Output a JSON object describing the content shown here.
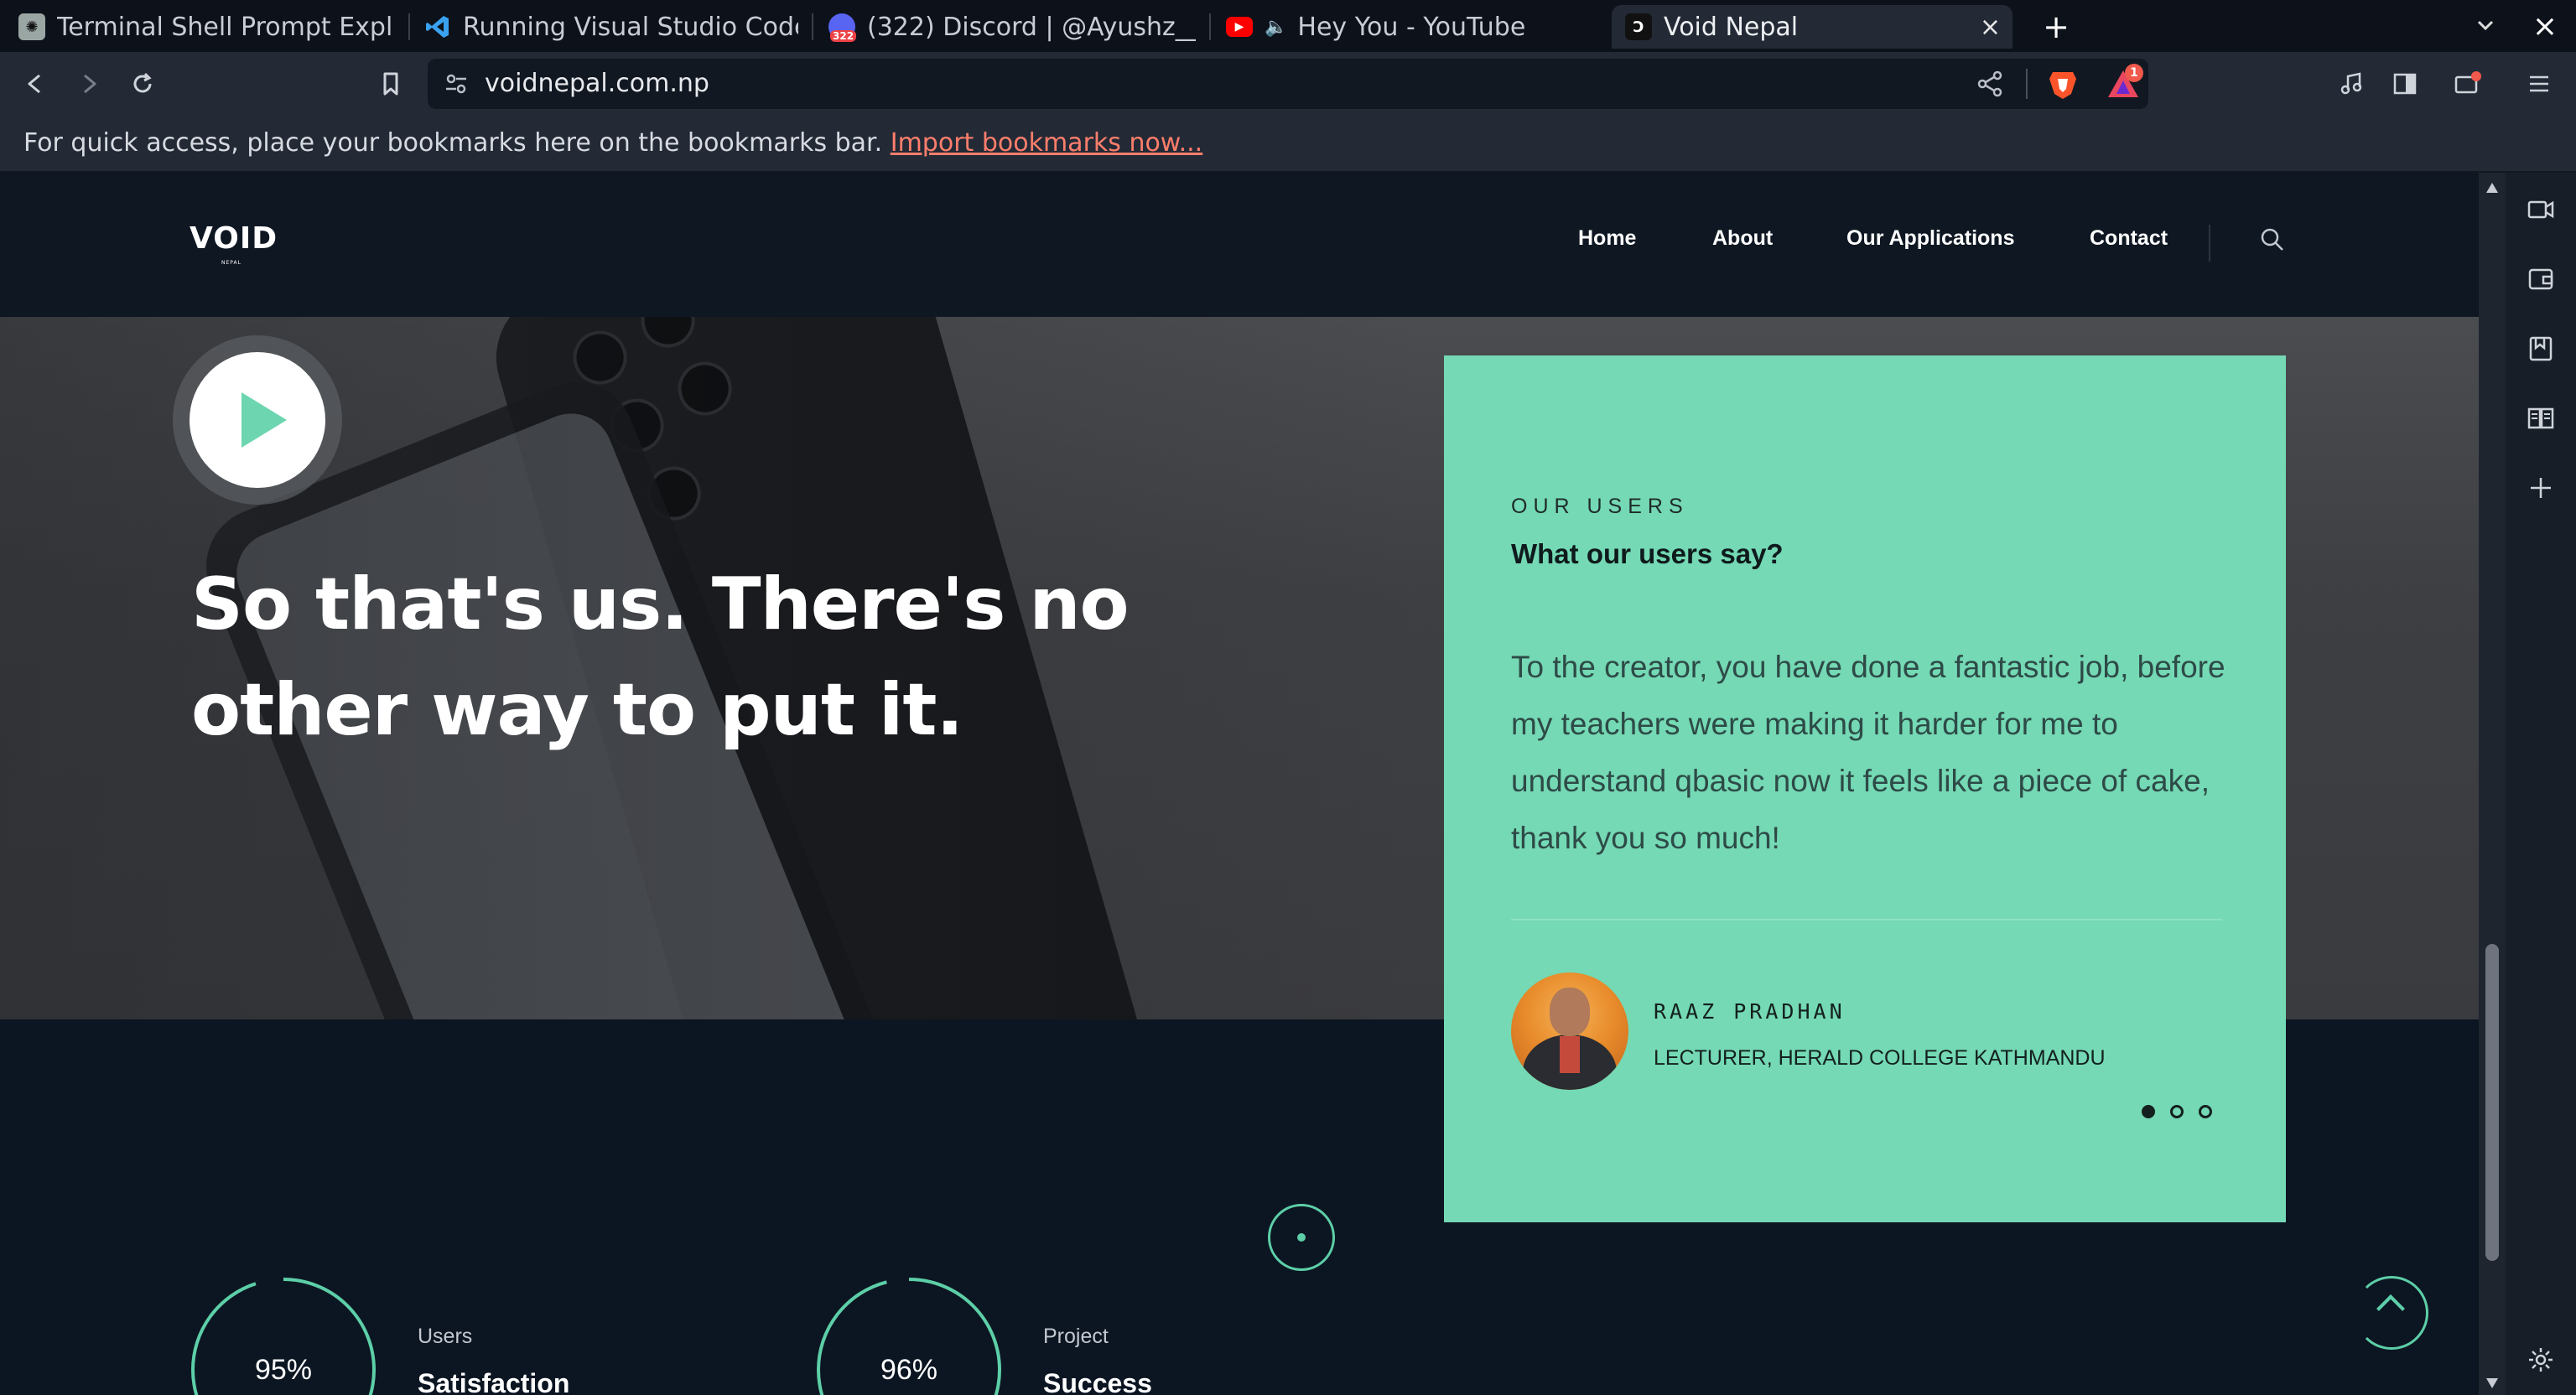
{
  "browser": {
    "tabs": [
      {
        "title": "Terminal Shell Prompt Explan",
        "favicon": "chatgpt-icon",
        "active": false
      },
      {
        "title": "Running Visual Studio Code o",
        "favicon": "vscode-icon",
        "active": false
      },
      {
        "title": "(322) Discord | @Ayushz__",
        "favicon": "discord-icon",
        "badge": "322",
        "active": false
      },
      {
        "title": "Hey You - YouTube",
        "favicon": "youtube-icon",
        "audio": true,
        "active": false
      },
      {
        "title": "Void Nepal",
        "favicon": "void-icon",
        "active": true
      }
    ],
    "new_tab_label": "+",
    "close_label": "×",
    "address": "voidnepal.com.np",
    "rewards_badge": "1",
    "bookmarks_message": "For quick access, place your bookmarks here on the bookmarks bar.",
    "bookmarks_link": "Import bookmarks now...",
    "colors": {
      "chrome_bg": "#232a36",
      "tabstrip_bg": "#0d111a",
      "link": "#ff7e6b"
    }
  },
  "site": {
    "logo_text": "VOID",
    "logo_sub": "NEPAL",
    "nav": [
      "Home",
      "About",
      "Our Applications",
      "Contact"
    ],
    "hero": {
      "title": "So that's us. There's no other way to put it."
    },
    "stats": [
      {
        "percent": "95%",
        "value": 0.95,
        "label": "Users",
        "title": "Satisfaction"
      },
      {
        "percent": "96%",
        "value": 0.96,
        "label": "Project",
        "title": "Success"
      }
    ],
    "testimonial": {
      "eyebrow": "OUR USERS",
      "heading": "What our users say?",
      "quote": "To the creator, you have done a fantastic job, before my teachers were making it harder for me to understand qbasic now it feels like a piece of cake, thank you so much!",
      "author": "RAAZ PRADHAN",
      "role": "LECTURER, HERALD COLLEGE KATHMANDU",
      "pages": 3,
      "current_page": 1
    },
    "colors": {
      "accent": "#5dcfa8",
      "card_bg": "#74d9b4",
      "page_bg": "#0c1622"
    }
  }
}
